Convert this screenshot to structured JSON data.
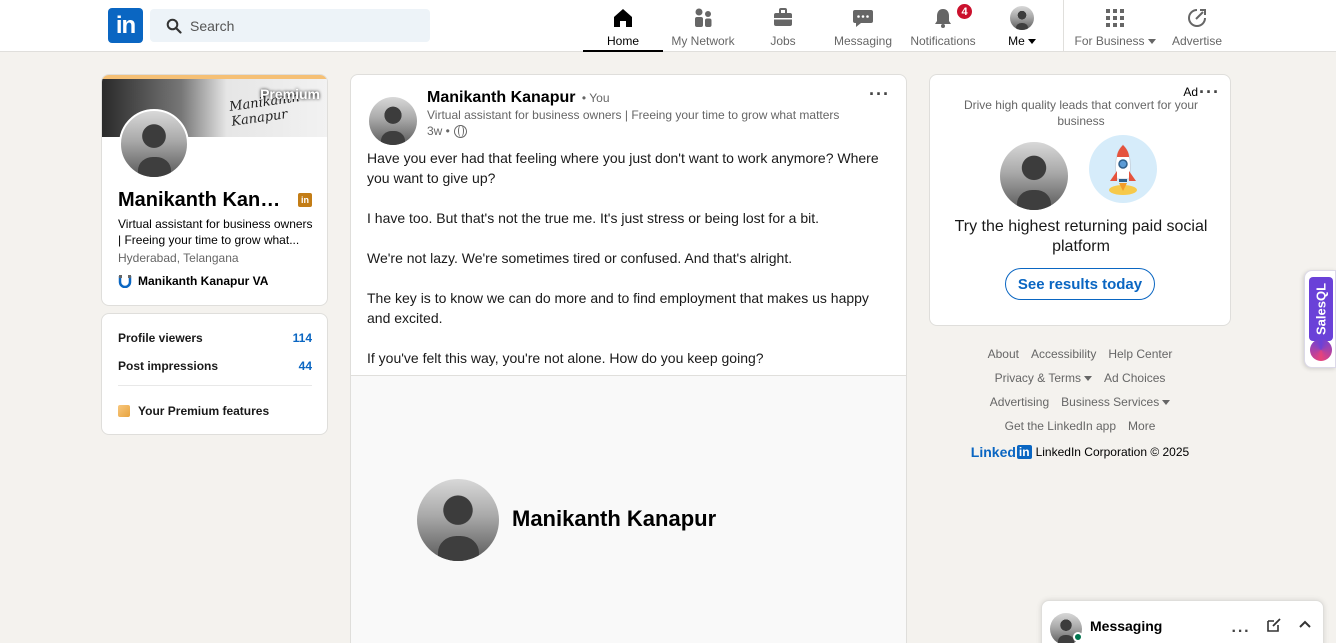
{
  "nav": {
    "search_placeholder": "Search",
    "items": [
      {
        "label": "Home",
        "icon": "home-icon"
      },
      {
        "label": "My Network",
        "icon": "network-icon"
      },
      {
        "label": "Jobs",
        "icon": "briefcase-icon"
      },
      {
        "label": "Messaging",
        "icon": "chat-icon"
      },
      {
        "label": "Notifications",
        "icon": "bell-icon",
        "badge": "4"
      },
      {
        "label": "Me",
        "icon": "avatar"
      },
      {
        "label": "For Business",
        "icon": "grid-icon"
      },
      {
        "label": "Advertise",
        "icon": "compass-icon"
      }
    ]
  },
  "profile": {
    "banner_label": "Premium",
    "banner_signature": "Manikanth Kanapur",
    "name": "Manikanth Kana...",
    "headline": "Virtual assistant for business owners | Freeing your time to grow what...",
    "location": "Hyderabad, Telangana",
    "company": "Manikanth Kanapur VA"
  },
  "stats": {
    "viewers_label": "Profile viewers",
    "viewers_value": "114",
    "impressions_label": "Post impressions",
    "impressions_value": "44",
    "premium_features": "Your Premium features"
  },
  "post": {
    "author": "Manikanth Kanapur",
    "you_label": "• You",
    "headline": "Virtual assistant for business owners | Freeing your time to grow what matters",
    "time": "3w •",
    "paragraphs": [
      "Have you ever had that feeling where you just don't want to work anymore? Where you want to give up?",
      "I have too. But that's not the true me. It's just stress or being lost for a bit.",
      "We're not lazy. We're sometimes tired or confused. And that's alright.",
      "The key is to know we can do more and to find employment that makes us happy and excited.",
      "If you've felt this way, you're not alone. How do you keep going?"
    ],
    "image_name": "Manikanth Kanapur"
  },
  "ad": {
    "label": "Ad",
    "description": "Drive high quality leads that convert for your business",
    "title": "Try the highest returning paid social platform",
    "button": "See results today"
  },
  "footer": {
    "row1": [
      "About",
      "Accessibility",
      "Help Center"
    ],
    "row2": [
      "Privacy & Terms",
      "Ad Choices"
    ],
    "row3": [
      "Advertising",
      "Business Services"
    ],
    "row4": [
      "Get the LinkedIn app",
      "More"
    ],
    "brand": "Linked",
    "brand_box": "in",
    "copyright": "LinkedIn Corporation © 2025"
  },
  "salesql": {
    "label": "SalesQL"
  },
  "messaging": {
    "title": "Messaging"
  },
  "colors": {
    "brand": "#0a66c2",
    "badge": "#cb112d",
    "premium": "#f5c075",
    "background": "#f4f2ee"
  }
}
